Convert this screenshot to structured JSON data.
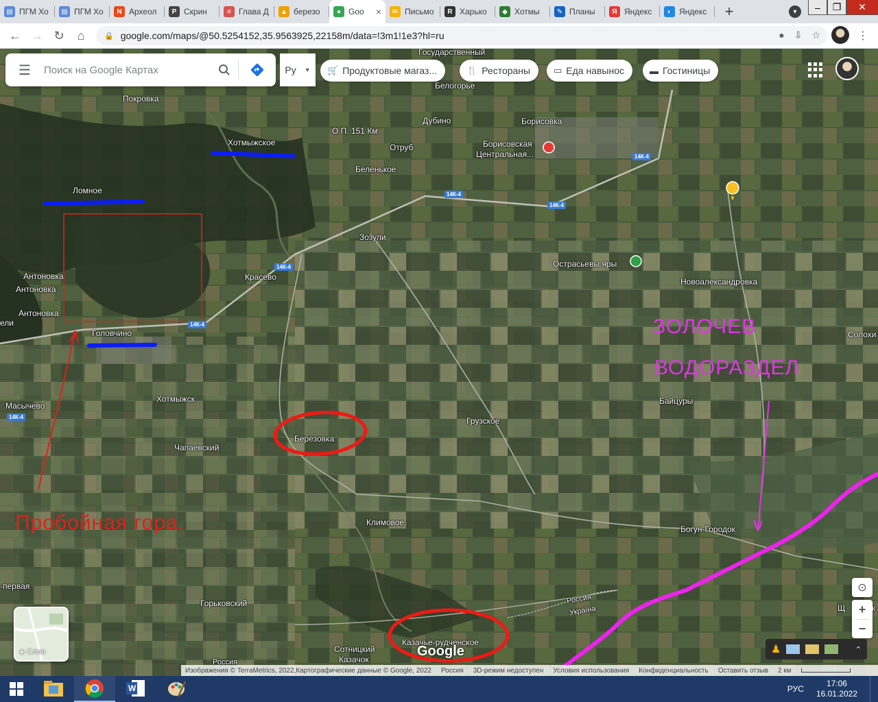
{
  "browser": {
    "tabs": [
      {
        "label": "ПГМ Хо",
        "icon": "document-icon",
        "color": "#5b8ad8"
      },
      {
        "label": "ПГМ Хо",
        "icon": "document-icon",
        "color": "#5b8ad8"
      },
      {
        "label": "Археол",
        "icon": "n1-icon",
        "color": "#e8491d"
      },
      {
        "label": "Скрин",
        "icon": "p-letter-icon",
        "color": "#444444"
      },
      {
        "label": "Глава Д",
        "icon": "book-icon",
        "color": "#d9534f"
      },
      {
        "label": "березо",
        "icon": "image-icon",
        "color": "#f0a000"
      },
      {
        "label": "Goo",
        "icon": "maps-pin-icon",
        "color": "#34a853",
        "active": true
      },
      {
        "label": "Письмо",
        "icon": "mail-icon",
        "color": "#f4b400"
      },
      {
        "label": "Харько",
        "icon": "r-letter-icon",
        "color": "#333333"
      },
      {
        "label": "Хотмы",
        "icon": "diamond-icon",
        "color": "#2e7d32"
      },
      {
        "label": "Планы",
        "icon": "pen-icon",
        "color": "#1565c0"
      },
      {
        "label": "Яндекс",
        "icon": "yandex-icon",
        "color": "#e53935"
      },
      {
        "label": "Яндекс",
        "icon": "yandex-browser-icon",
        "color": "#1e88e5"
      }
    ],
    "new_tab": "+",
    "close_tab": "×",
    "url": "google.com/maps/@50.5254152,35.9563925,22158m/data=!3m1!1e3?hl=ru"
  },
  "maps": {
    "search_placeholder": "Поиск на Google Картах",
    "language": "Ру",
    "chips": [
      {
        "label": "Продуктовые магаз...",
        "icon": "cart-icon"
      },
      {
        "label": "Рестораны",
        "icon": "fork-knife-icon"
      },
      {
        "label": "Еда навынос",
        "icon": "takeout-icon"
      },
      {
        "label": "Гостиницы",
        "icon": "bed-icon"
      }
    ],
    "layers_label": "Слои",
    "google_logo": "Google",
    "attribution": [
      "Изображения © TerraMetrics, 2022,Картографические данные © Google, 2022",
      "Россия",
      "3D-режим недоступен",
      "Условия использования",
      "Конфиденциальность",
      "Оставить отзыв",
      "2 км"
    ],
    "places": {
      "gos": "Государственный",
      "belogorye": "Белогорье",
      "pokrovka": "Покровка",
      "dubino": "Дубино",
      "borisovka": "Борисовка",
      "op151": "О.П. 151 Км",
      "otrub": "Отруб",
      "hospital1": "Борисовская",
      "hospital2": "Центральная...",
      "khotmyzhskoe": "Хотмыжское",
      "belenkoe": "Беленькое",
      "lomnoe": "Ломное",
      "zozuli": "Зозули",
      "ostrasevy": "Острасьевы яры",
      "antonovka1": "Антоновка",
      "antonovka2": "Антоновка",
      "antonovka3": "Антоновка",
      "krasevo": "Красево",
      "novoaleksandrovka": "Новоалександровка",
      "eli": "ели",
      "golovchino": "Головчино",
      "solokhi": "Солохи",
      "masychevo": "Масычево",
      "khotmyzhsk": "Хотмыжск",
      "baitsury": "Байцуры",
      "gruzskoe": "Грузское",
      "berezovka": "Березовка",
      "chapaevsky": "Чапаевский",
      "klimovoe": "Климовое",
      "bogun": "Богун-Городок",
      "pervaya": "-первая",
      "gorkovsky": "Горьковский",
      "russia": "Россия",
      "ukraine": "Україна",
      "kazachye": "Казачье-рудченское",
      "sotnitsky": "Сотницкий",
      "kazachok": "Казачок",
      "russia2": "Россия",
      "shch": "Щ",
      "ovk": "овк"
    },
    "road_shields": [
      "14К-4",
      "14К-4",
      "14К-4",
      "14К-4",
      "14К-4",
      "14К-4"
    ]
  },
  "annotations": {
    "proboinaya": "Пробойная гора.",
    "zolochev": "ЗОЛОЧЕВ",
    "vodorazdel": "ВОДОРАЗДЕЛ"
  },
  "taskbar": {
    "apps": [
      {
        "icon": "file-explorer-icon"
      },
      {
        "icon": "chrome-icon"
      },
      {
        "icon": "word-icon"
      },
      {
        "icon": "paint-icon"
      }
    ],
    "language": "РУС",
    "time": "17:06",
    "date": "16.01.2022"
  }
}
